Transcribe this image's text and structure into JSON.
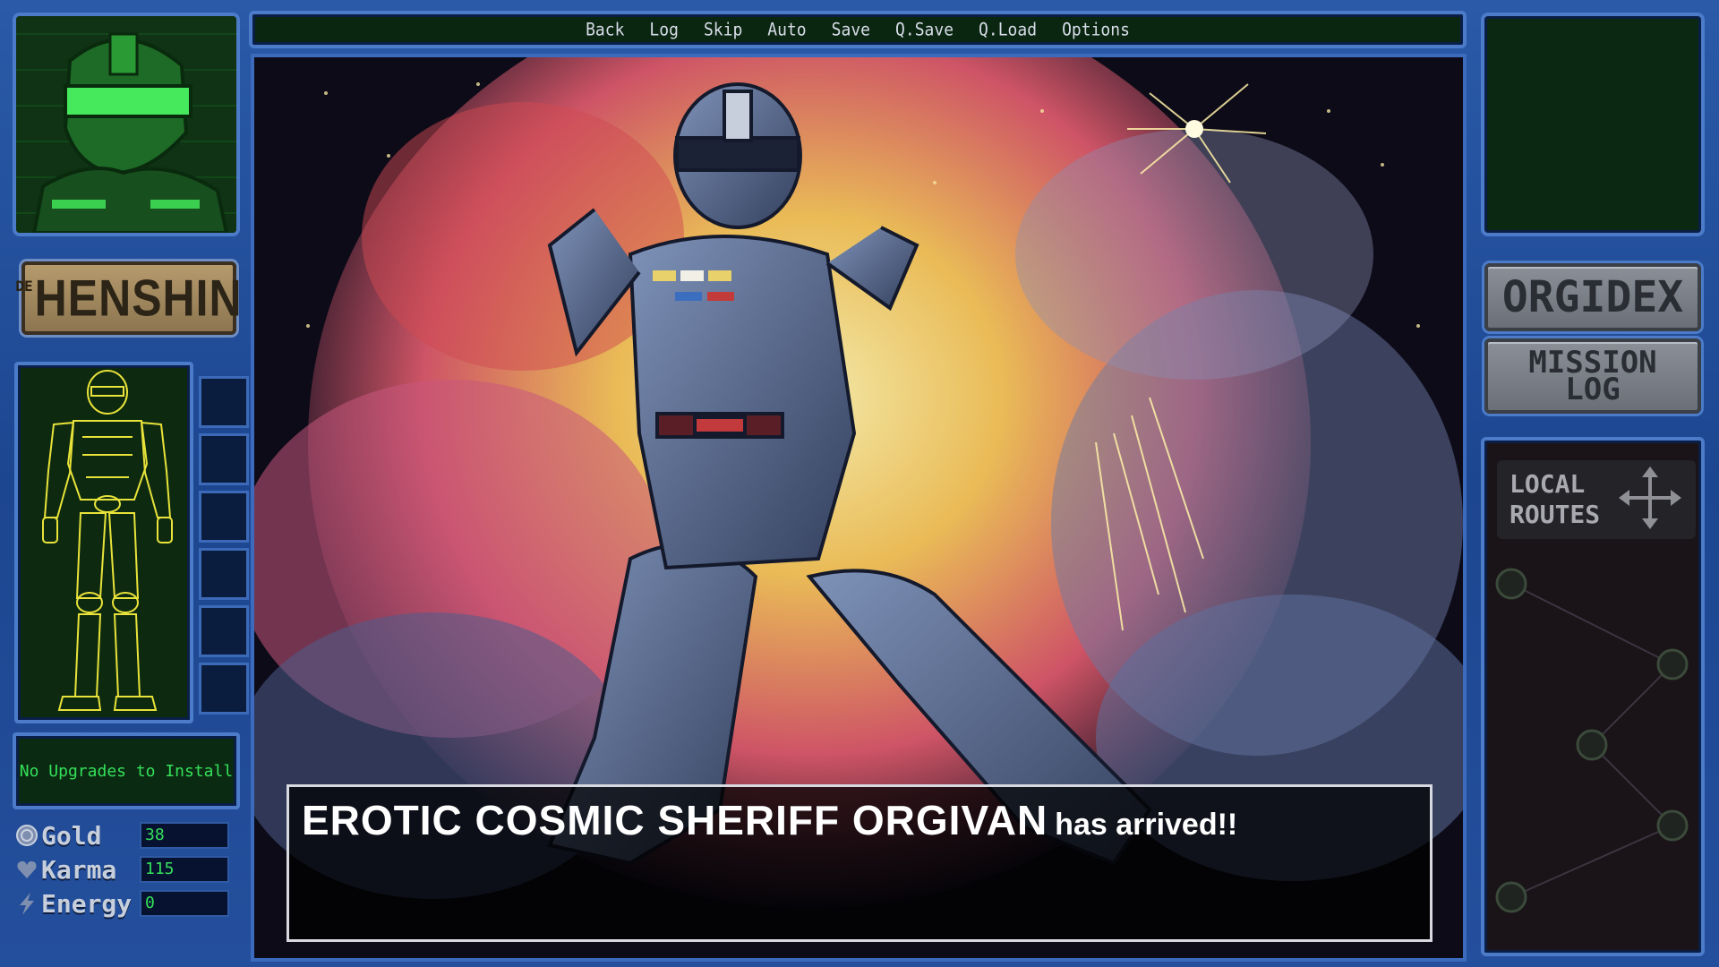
{
  "menu": {
    "items": [
      "Back",
      "Log",
      "Skip",
      "Auto",
      "Save",
      "Q.Save",
      "Q.Load",
      "Options"
    ]
  },
  "left": {
    "logo": {
      "prefix": "DE",
      "main": "HENSHIN"
    },
    "upgrade_status": "No Upgrades to Install",
    "stats": [
      {
        "label": "Gold",
        "value": "38",
        "icon": "coin-icon"
      },
      {
        "label": "Karma",
        "value": "115",
        "icon": "heart-icon"
      },
      {
        "label": "Energy",
        "value": "0",
        "icon": "lightning-icon"
      }
    ]
  },
  "right": {
    "orgidex_label": "ORGIDEX",
    "mission_label_1": "MISSION",
    "mission_label_2": "LOG",
    "routes_label_1": "LOCAL",
    "routes_label_2": "ROUTES"
  },
  "dialogue": {
    "speaker": "EROTIC COSMIC SHERIFF ORGIVAN",
    "text": "has arrived!!"
  },
  "colors": {
    "frame": "#2a5aa8",
    "terminal_green": "#34e05a",
    "wireframe_yellow": "#e8e23a"
  }
}
